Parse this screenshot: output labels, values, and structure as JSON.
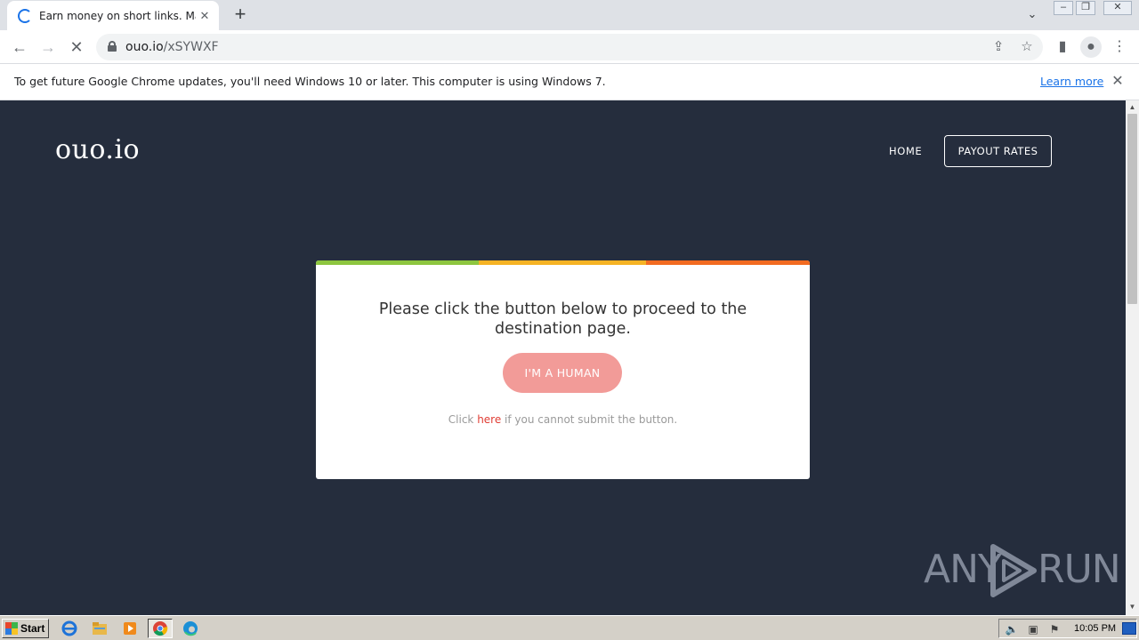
{
  "browser": {
    "tab": {
      "title": "Earn money on short links. Make sho",
      "close_glyph": "✕"
    },
    "new_tab_glyph": "+",
    "tab_search_glyph": "⌄",
    "window_controls": {
      "minimize": "–",
      "restore": "❐",
      "close": "✕"
    },
    "nav": {
      "back": "←",
      "forward": "→",
      "stop": "✕"
    },
    "address": {
      "host": "ouo.io",
      "path": "/xSYWXF"
    },
    "toolbar_icons": {
      "share": "⇪",
      "bookmark": "☆",
      "side_panel": "▮",
      "profile": "●",
      "menu": "⋮"
    }
  },
  "infobar": {
    "message": "To get future Google Chrome updates, you'll need Windows 10 or later. This computer is using Windows 7.",
    "learn_more": "Learn more",
    "close_glyph": "✕"
  },
  "site": {
    "logo": "ouo.io",
    "nav": {
      "home": "HOME",
      "payout": "PAYOUT RATES"
    },
    "card": {
      "message": "Please click the button below to proceed to the destination page.",
      "button": "I'M A HUMAN",
      "note_prefix": "Click ",
      "note_link": "here",
      "note_suffix": " if you cannot submit the button."
    },
    "colors": {
      "background": "#252d3d",
      "button": "#f29b98",
      "link": "#e03e35",
      "bar": [
        "#8dc63f",
        "#f5b324",
        "#f26b21"
      ]
    }
  },
  "watermark": {
    "left": "ANY",
    "right": "RUN"
  },
  "scrollbar": {
    "up": "▲",
    "down": "▼"
  },
  "taskbar": {
    "start": "Start",
    "apps": [
      "internet-explorer-icon",
      "file-explorer-icon",
      "media-player-icon",
      "chrome-icon",
      "edge-icon"
    ],
    "tray": {
      "volume": "🔈",
      "network": "▣",
      "flag": "⚑"
    },
    "clock": "10:05 PM"
  }
}
